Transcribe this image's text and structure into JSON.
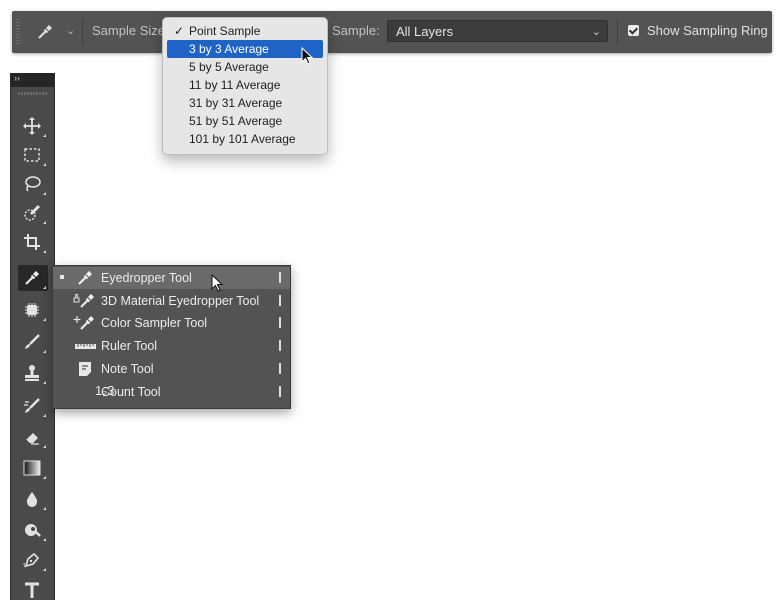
{
  "options_bar": {
    "tool_preset_icon": "eyedropper-icon",
    "sample_size_label": "Sample Size:",
    "sample_label": "Sample:",
    "sample_value": "All Layers",
    "show_sampling_ring_label": "Show Sampling Ring",
    "show_sampling_ring_checked": true
  },
  "sample_size_menu": {
    "items": [
      {
        "label": "Point Sample",
        "checked": true,
        "highlighted": false
      },
      {
        "label": "3 by 3 Average",
        "checked": false,
        "highlighted": true
      },
      {
        "label": "5 by 5 Average",
        "checked": false,
        "highlighted": false
      },
      {
        "label": "11 by 11 Average",
        "checked": false,
        "highlighted": false
      },
      {
        "label": "31 by 31 Average",
        "checked": false,
        "highlighted": false
      },
      {
        "label": "51 by 51 Average",
        "checked": false,
        "highlighted": false
      },
      {
        "label": "101 by 101 Average",
        "checked": false,
        "highlighted": false
      }
    ],
    "check_glyph": "✓"
  },
  "toolbar": {
    "collapse_glyph": "››",
    "tools": [
      {
        "name": "move-tool",
        "icon": "move-icon"
      },
      {
        "name": "marquee-tool",
        "icon": "marquee-icon"
      },
      {
        "name": "lasso-tool",
        "icon": "lasso-icon"
      },
      {
        "name": "quick-selection-tool",
        "icon": "quick-selection-icon"
      },
      {
        "name": "crop-tool",
        "icon": "crop-icon"
      },
      {
        "name": "eyedropper-tool",
        "icon": "eyedropper-icon",
        "active": true
      },
      {
        "name": "healing-brush-tool",
        "icon": "healing-icon"
      },
      {
        "name": "brush-tool",
        "icon": "brush-icon"
      },
      {
        "name": "clone-stamp-tool",
        "icon": "stamp-icon"
      },
      {
        "name": "history-brush-tool",
        "icon": "history-brush-icon"
      },
      {
        "name": "eraser-tool",
        "icon": "eraser-icon"
      },
      {
        "name": "gradient-tool",
        "icon": "gradient-icon"
      },
      {
        "name": "blur-tool",
        "icon": "blur-icon"
      },
      {
        "name": "dodge-tool",
        "icon": "dodge-icon"
      },
      {
        "name": "pen-tool",
        "icon": "pen-icon"
      },
      {
        "name": "type-tool",
        "icon": "type-icon"
      }
    ]
  },
  "tool_flyout": {
    "items": [
      {
        "label": "Eyedropper Tool",
        "icon": "eyedropper-icon",
        "selected": true
      },
      {
        "label": "3D Material Eyedropper Tool",
        "icon": "3d-eyedropper-icon",
        "selected": false
      },
      {
        "label": "Color Sampler Tool",
        "icon": "color-sampler-icon",
        "selected": false
      },
      {
        "label": "Ruler Tool",
        "icon": "ruler-icon",
        "selected": false
      },
      {
        "label": "Note Tool",
        "icon": "note-icon",
        "selected": false
      },
      {
        "label": "Count Tool",
        "icon": "count-icon",
        "selected": false
      }
    ],
    "shortcut_key": "I",
    "count_glyph": "1₂3"
  },
  "colors": {
    "options_bar_bg": "#535353",
    "menu_highlight": "#1f63c6",
    "toolbar_bg": "#4a4a4a"
  }
}
